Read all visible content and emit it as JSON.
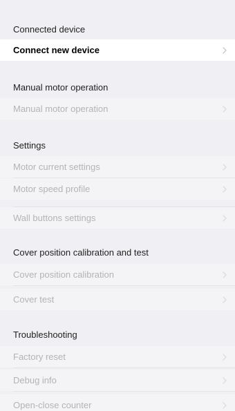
{
  "sections": [
    {
      "title": "Connected device",
      "items": [
        {
          "label": "Connect new device",
          "enabled": true
        }
      ]
    },
    {
      "title": "Manual motor operation",
      "items": [
        {
          "label": "Manual motor operation",
          "enabled": false
        }
      ]
    },
    {
      "title": "Settings",
      "items": [
        {
          "label": "Motor current settings",
          "enabled": false
        },
        {
          "label": "Motor speed profile",
          "enabled": false
        },
        {
          "label": "Wall buttons settings",
          "enabled": false
        }
      ]
    },
    {
      "title": "Cover position calibration and test",
      "items": [
        {
          "label": "Cover position calibration",
          "enabled": false
        },
        {
          "label": "Cover test",
          "enabled": false
        }
      ]
    },
    {
      "title": "Troubleshooting",
      "items": [
        {
          "label": "Factory reset",
          "enabled": false
        },
        {
          "label": "Debug info",
          "enabled": false
        },
        {
          "label": "Open-close counter",
          "enabled": false
        }
      ]
    }
  ],
  "icons": {
    "row_trailing": "chevron-right-icon"
  },
  "colors": {
    "background": "#efeff4",
    "row_active_bg": "#ffffff",
    "row_disabled_bg": "#f4f4f6",
    "text_active": "#000000",
    "text_disabled": "#b3b3b8",
    "chevron": "#c7c7cc"
  }
}
